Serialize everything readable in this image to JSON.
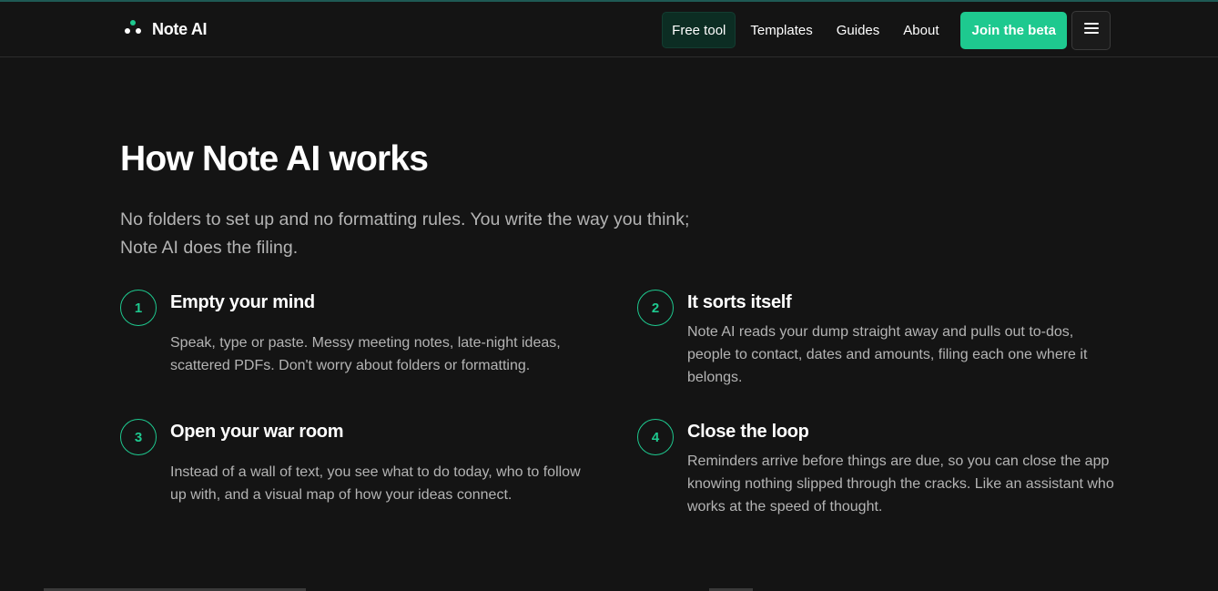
{
  "brand": {
    "name": "Note AI",
    "icon": "three-dots-logo-icon",
    "accent": "#1ec98f"
  },
  "nav": {
    "links": [
      "Free tool",
      "Templates",
      "Guides",
      "About"
    ],
    "cta": "Join the beta",
    "menu_icon": "hamburger-menu-icon"
  },
  "hero": {
    "title": "How Note AI works",
    "intro": "No folders to set up and no formatting rules. You write the way you think; Note AI does the filing."
  },
  "steps": [
    {
      "num": "1",
      "title": "Empty your mind",
      "body": "Speak, type or paste. Messy meeting notes, late-night ideas, scattered PDFs. Don't worry about folders or formatting."
    },
    {
      "num": "2",
      "title": "It sorts itself",
      "body": "Note AI reads your dump straight away and pulls out to-dos, people to contact, dates and amounts, filing each one where it belongs."
    },
    {
      "num": "3",
      "title": "Open your war room",
      "body": "Instead of a wall of text, you see what to do today, who to follow up with, and a visual map of how your ideas connect."
    },
    {
      "num": "4",
      "title": "Close the loop",
      "body": "Reminders arrive before things are due, so you can close the app knowing nothing slipped through the cracks. Like an assistant who works at the speed of thought."
    }
  ]
}
